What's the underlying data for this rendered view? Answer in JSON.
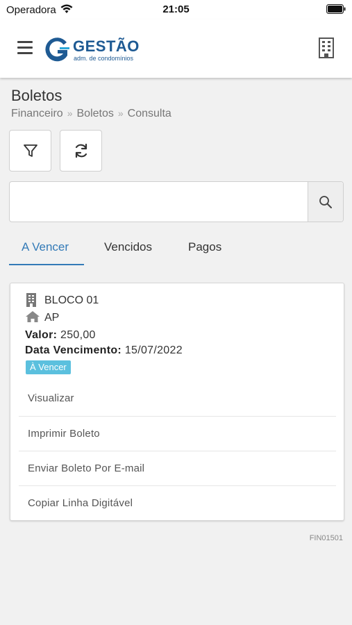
{
  "status_bar": {
    "carrier": "Operadora",
    "time": "21:05"
  },
  "header": {
    "logo_text": "GESTÃO",
    "logo_subtitle": "adm. de condomínios"
  },
  "page": {
    "title": "Boletos",
    "breadcrumb": [
      "Financeiro",
      "Boletos",
      "Consulta"
    ]
  },
  "search": {
    "value": "",
    "placeholder": ""
  },
  "tabs": [
    {
      "label": "A Vencer",
      "active": true
    },
    {
      "label": "Vencidos",
      "active": false
    },
    {
      "label": "Pagos",
      "active": false
    }
  ],
  "boleto": {
    "block": "BLOCO 01",
    "unit": "AP",
    "valor_label": "Valor:",
    "valor": "250,00",
    "vencimento_label": "Data Vencimento:",
    "vencimento": "15/07/2022",
    "status": "À Vencer",
    "actions": [
      "Visualizar",
      "Imprimir Boleto",
      "Enviar Boleto Por E-mail",
      "Copiar Linha Digitável"
    ]
  },
  "page_code": "FIN01501",
  "colors": {
    "brand": "#1e5a93",
    "accent": "#337ab7",
    "badge": "#5bc0de"
  },
  "icons": [
    "wifi-icon",
    "battery-icon",
    "menu-icon",
    "building-icon",
    "filter-icon",
    "refresh-icon",
    "search-icon",
    "house-icon"
  ]
}
